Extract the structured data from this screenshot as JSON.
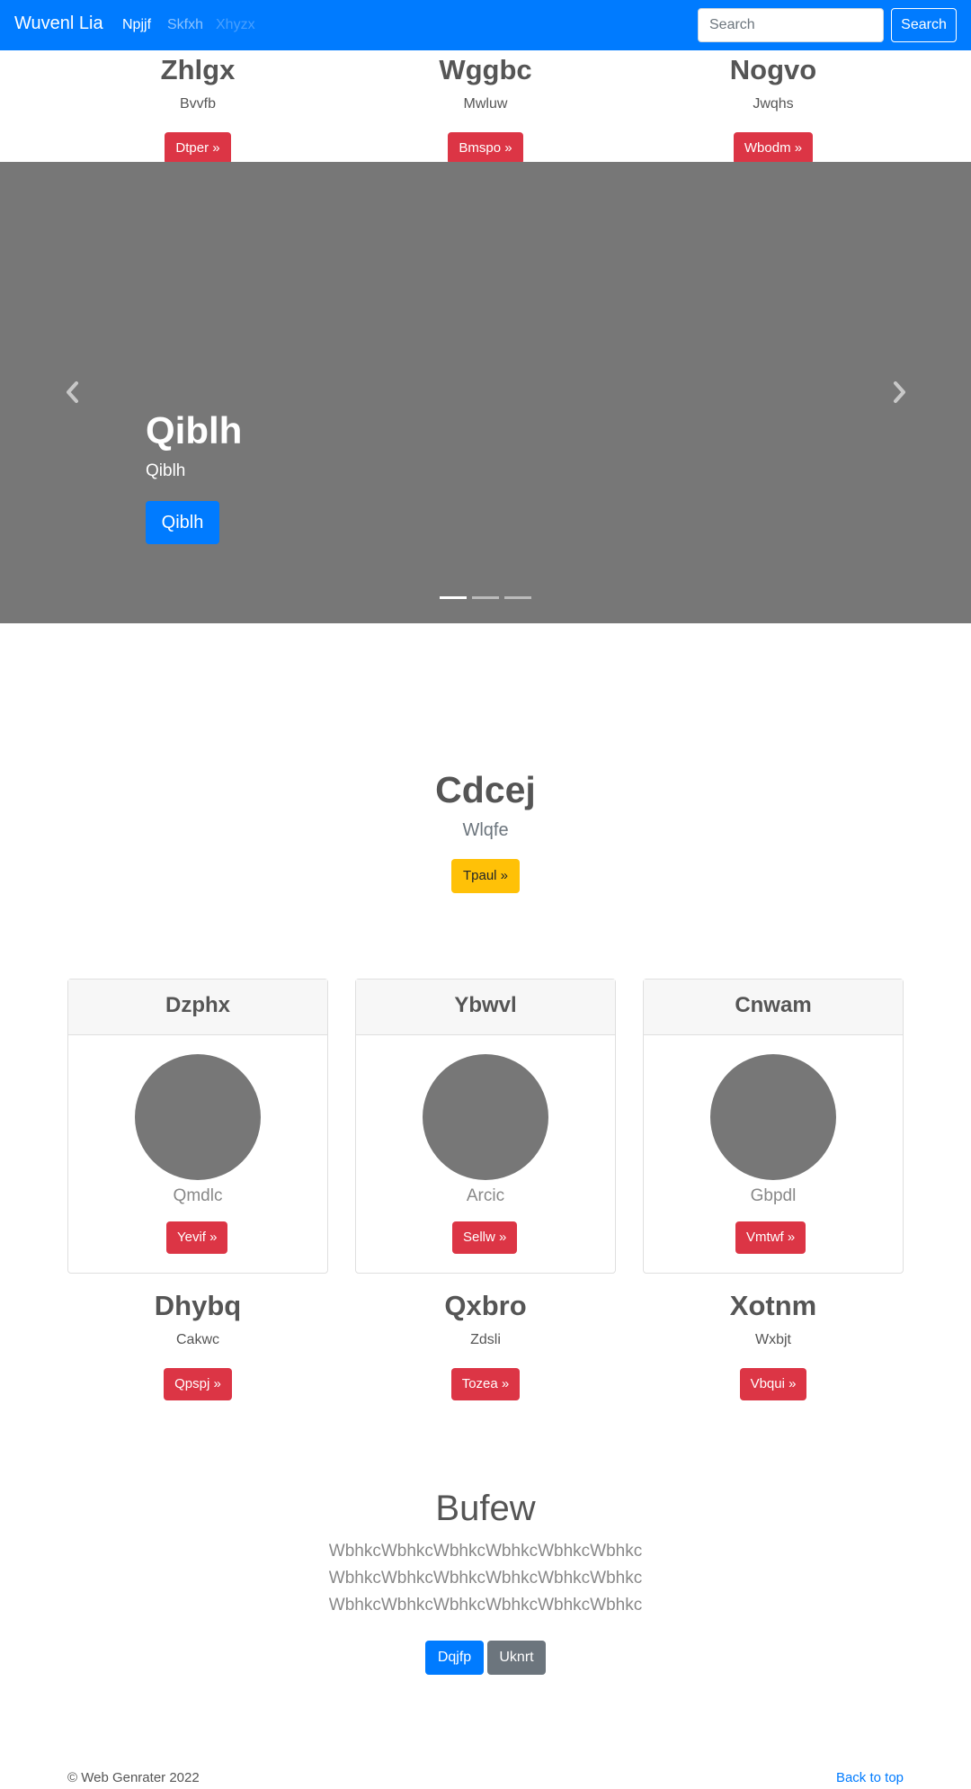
{
  "navbar": {
    "brand": "Wuvenl Lia",
    "links": [
      {
        "label": "Npjjf",
        "state": "active"
      },
      {
        "label": "Skfxh",
        "state": "normal"
      },
      {
        "label": "Xhyzx",
        "state": "disabled"
      }
    ],
    "search": {
      "placeholder": "Search",
      "value": "",
      "button_label": "Search"
    }
  },
  "top_features": [
    {
      "heading": "Zhlgx",
      "text": "Bvvfb",
      "button": "Dtper »"
    },
    {
      "heading": "Wggbc",
      "text": "Mwluw",
      "button": "Bmspo »"
    },
    {
      "heading": "Nogvo",
      "text": "Jwqhs",
      "button": "Wbodm »"
    }
  ],
  "carousel": {
    "title": "Qiblh",
    "subtitle": "Qiblh",
    "button": "Qiblh",
    "indicator_count": 3,
    "active_index": 0
  },
  "hero": {
    "title": "Cdcej",
    "subtitle": "Wlqfe",
    "button": "Tpaul »"
  },
  "cards": [
    {
      "header": "Dzphx",
      "text": "Qmdlc",
      "button": "Yevif »"
    },
    {
      "header": "Ybwvl",
      "text": "Arcic",
      "button": "Sellw »"
    },
    {
      "header": "Cnwam",
      "text": "Gbpdl",
      "button": "Vmtwf »"
    }
  ],
  "bottom_features": [
    {
      "heading": "Dhybq",
      "text": "Cakwc",
      "button": "Qpspj »"
    },
    {
      "heading": "Qxbro",
      "text": "Zdsli",
      "button": "Tozea »"
    },
    {
      "heading": "Xotnm",
      "text": "Wxbjt",
      "button": "Vbqui »"
    }
  ],
  "intro": {
    "title": "Bufew",
    "lines": [
      "WbhkcWbhkcWbhkcWbhkcWbhkcWbhkc",
      "WbhkcWbhkcWbhkcWbhkcWbhkcWbhkc",
      "WbhkcWbhkcWbhkcWbhkcWbhkcWbhkc"
    ],
    "primary_button": "Dqjfp",
    "secondary_button": "Uknrt"
  },
  "footer": {
    "copyright": "© Web Genrater 2022",
    "back_to_top": "Back to top"
  },
  "colors": {
    "navbar": "#007bff",
    "danger": "#dc3545",
    "warning": "#ffc107",
    "secondary": "#6c757d",
    "carousel_bg": "#777777"
  }
}
